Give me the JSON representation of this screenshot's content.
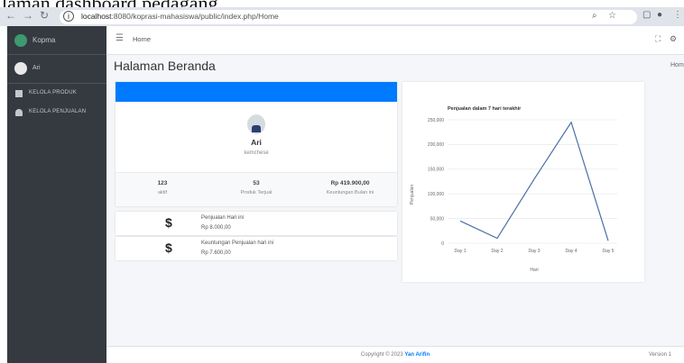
{
  "caption": "laman dashboard pedagang",
  "browser": {
    "url_host": "localhost",
    "url_path": ":8080/koprasi-mahasiswa/public/index.php/Home"
  },
  "sidebar": {
    "brand": "Kopma",
    "user": "Ari",
    "items": [
      {
        "label": "KELOLA PRODUK",
        "icon": "box-icon"
      },
      {
        "label": "KELOLA PENJUALAN",
        "icon": "user-icon"
      }
    ]
  },
  "topbar": {
    "home": "Home"
  },
  "page": {
    "title": "Halaman Beranda",
    "breadcrumb": "Hom"
  },
  "profile": {
    "name": "Ari",
    "role": "kemchese",
    "stats": [
      {
        "value": "123",
        "label": "aktif"
      },
      {
        "value": "53",
        "label": "Produk Terjual"
      },
      {
        "value": "Rp 419.900,00",
        "label": "Keuntungan Bulan ini"
      }
    ]
  },
  "info_boxes": [
    {
      "icon": "$",
      "title": "Penjualan Hari ini",
      "value": "Rp 8.000,00"
    },
    {
      "icon": "$",
      "title": "Keuntungan Penjualan hari ini",
      "value": "Rp 7.600,00"
    }
  ],
  "chart_data": {
    "type": "line",
    "title": "Penjualan dalam 7 hari terakhir",
    "xlabel": "Hari",
    "ylabel": "Penjualan",
    "categories": [
      "Day 1",
      "Day 2",
      "Day 3",
      "Day 4",
      "Day 5"
    ],
    "values": [
      45000,
      10000,
      130000,
      245000,
      5000
    ],
    "ylim": [
      0,
      250000
    ],
    "yticks": [
      "0",
      "50,000",
      "100,000",
      "150,000",
      "200,000",
      "250,000"
    ],
    "grid": true,
    "color": "#4a6fa5"
  },
  "footer": {
    "copyright": "Copyright © 2023",
    "author": "Yan Arifin",
    "version": "Version 1"
  },
  "colors": {
    "sidebar": "#343a40",
    "primary": "#007bff",
    "background": "#f4f6f9"
  }
}
